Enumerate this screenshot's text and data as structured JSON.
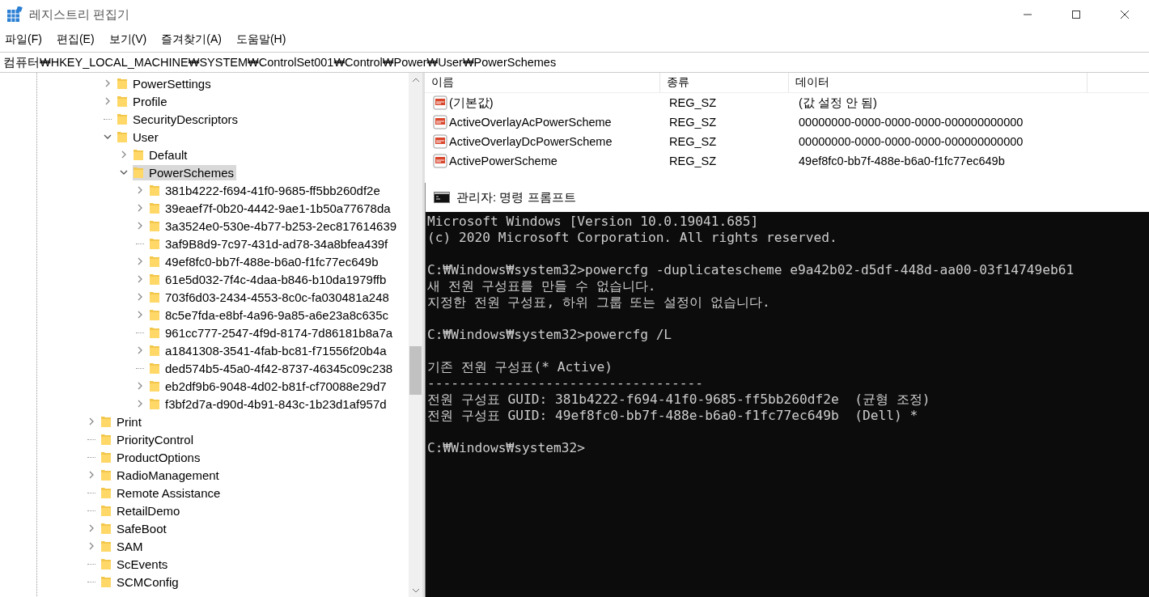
{
  "window": {
    "title": "레지스트리 편집기"
  },
  "menu": [
    "파일(F)",
    "편집(E)",
    "보기(V)",
    "즐겨찾기(A)",
    "도움말(H)"
  ],
  "address": "컴퓨터₩HKEY_LOCAL_MACHINE₩SYSTEM₩ControlSet001₩Control₩Power₩User₩PowerSchemes",
  "tree": {
    "branch": [
      {
        "label": "PowerSettings",
        "expandable": true,
        "expanded": false,
        "selected": false
      },
      {
        "label": "Profile",
        "expandable": true,
        "expanded": false,
        "selected": false
      },
      {
        "label": "SecurityDescriptors",
        "expandable": false,
        "selected": false
      },
      {
        "label": "User",
        "expandable": true,
        "expanded": true,
        "selected": false,
        "children": [
          {
            "label": "Default",
            "expandable": true,
            "expanded": false,
            "selected": false
          },
          {
            "label": "PowerSchemes",
            "expandable": true,
            "expanded": true,
            "selected": true,
            "children": [
              {
                "label": "381b4222-f694-41f0-9685-ff5bb260df2e",
                "expandable": true,
                "expanded": false,
                "selected": false
              },
              {
                "label": "39eaef7f-0b20-4442-9ae1-1b50a77678da",
                "expandable": true,
                "expanded": false,
                "selected": false
              },
              {
                "label": "3a3524e0-530e-4b77-b253-2ec817614639",
                "expandable": true,
                "expanded": false,
                "selected": false
              },
              {
                "label": "3af9B8d9-7c97-431d-ad78-34a8bfea439f",
                "expandable": false,
                "selected": false
              },
              {
                "label": "49ef8fc0-bb7f-488e-b6a0-f1fc77ec649b",
                "expandable": true,
                "expanded": false,
                "selected": false
              },
              {
                "label": "61e5d032-7f4c-4daa-b846-b10da1979ffb",
                "expandable": true,
                "expanded": false,
                "selected": false
              },
              {
                "label": "703f6d03-2434-4553-8c0c-fa030481a248",
                "expandable": true,
                "expanded": false,
                "selected": false
              },
              {
                "label": "8c5e7fda-e8bf-4a96-9a85-a6e23a8c635c",
                "expandable": true,
                "expanded": false,
                "selected": false
              },
              {
                "label": "961cc777-2547-4f9d-8174-7d86181b8a7a",
                "expandable": false,
                "selected": false
              },
              {
                "label": "a1841308-3541-4fab-bc81-f71556f20b4a",
                "expandable": true,
                "expanded": false,
                "selected": false
              },
              {
                "label": "ded574b5-45a0-4f42-8737-46345c09c238",
                "expandable": false,
                "selected": false
              },
              {
                "label": "eb2df9b6-9048-4d02-b81f-cf70088e29d7",
                "expandable": true,
                "expanded": false,
                "selected": false
              },
              {
                "label": "f3bf2d7a-d90d-4b91-843c-1b23d1af957d",
                "expandable": true,
                "expanded": false,
                "selected": false
              }
            ]
          }
        ]
      }
    ],
    "items": [
      {
        "label": "Print",
        "expandable": true,
        "expanded": false,
        "selected": false
      },
      {
        "label": "PriorityControl",
        "expandable": false,
        "selected": false
      },
      {
        "label": "ProductOptions",
        "expandable": false,
        "selected": false
      },
      {
        "label": "RadioManagement",
        "expandable": true,
        "expanded": false,
        "selected": false
      },
      {
        "label": "Remote Assistance",
        "expandable": false,
        "selected": false
      },
      {
        "label": "RetailDemo",
        "expandable": false,
        "selected": false
      },
      {
        "label": "SafeBoot",
        "expandable": true,
        "expanded": false,
        "selected": false
      },
      {
        "label": "SAM",
        "expandable": true,
        "expanded": false,
        "selected": false
      },
      {
        "label": "ScEvents",
        "expandable": false,
        "selected": false
      },
      {
        "label": "SCMConfig",
        "expandable": false,
        "selected": false
      }
    ]
  },
  "values": {
    "columns": [
      "이름",
      "종류",
      "데이터"
    ],
    "rows": [
      {
        "name": "(기본값)",
        "type": "REG_SZ",
        "data": "(값 설정 안 됨)"
      },
      {
        "name": "ActiveOverlayAcPowerScheme",
        "type": "REG_SZ",
        "data": "00000000-0000-0000-0000-000000000000"
      },
      {
        "name": "ActiveOverlayDcPowerScheme",
        "type": "REG_SZ",
        "data": "00000000-0000-0000-0000-000000000000"
      },
      {
        "name": "ActivePowerScheme",
        "type": "REG_SZ",
        "data": "49ef8fc0-bb7f-488e-b6a0-f1fc77ec649b"
      }
    ]
  },
  "console": {
    "title": "관리자: 명령 프롬프트",
    "blocks": [
      [
        "Microsoft Windows [Version 10.0.19041.685]",
        "(c) 2020 Microsoft Corporation. All rights reserved."
      ],
      [
        "C:₩Windows₩system32>powercfg -duplicatescheme e9a42b02-d5df-448d-aa00-03f14749eb61",
        "새 전원 구성표를 만들 수 없습니다.",
        "지정한 전원 구성표, 하위 그룹 또는 설정이 없습니다."
      ],
      [
        "C:₩Windows₩system32>powercfg /L"
      ],
      [
        "기존 전원 구성표(* Active)",
        "-----------------------------------",
        "전원 구성표 GUID: 381b4222-f694-41f0-9685-ff5bb260df2e  (균형 조정)",
        "전원 구성표 GUID: 49ef8fc0-bb7f-488e-b6a0-f1fc77ec649b  (Dell) *"
      ],
      [
        "C:₩Windows₩system32>"
      ]
    ]
  }
}
